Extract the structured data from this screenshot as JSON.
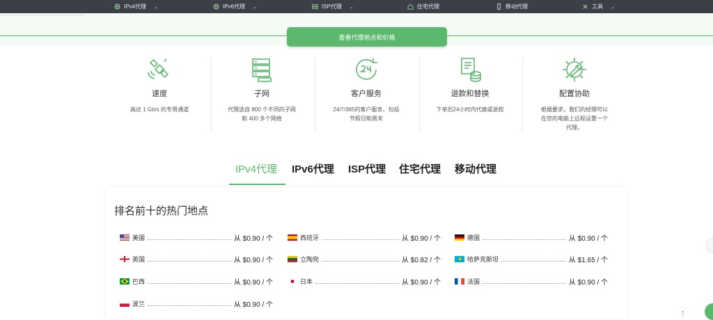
{
  "nav": {
    "items": [
      {
        "label": "IPv4代理",
        "icon": "globe-icon",
        "has_dropdown": true
      },
      {
        "label": "IPv6代理",
        "icon": "globe-icon",
        "has_dropdown": true
      },
      {
        "label": "ISP代理",
        "icon": "server-icon",
        "has_dropdown": true
      },
      {
        "label": "住宅代理",
        "icon": "home-icon",
        "has_dropdown": false
      },
      {
        "label": "移动代理",
        "icon": "mobile-icon",
        "has_dropdown": false
      },
      {
        "label": "工具",
        "icon": "tools-icon",
        "has_dropdown": true
      }
    ]
  },
  "cta": {
    "label": "查看代理地点和价格"
  },
  "features": [
    {
      "icon": "satellite-icon",
      "title": "速度",
      "desc": [
        "高达 1 Gb/s 的专用通道"
      ]
    },
    {
      "icon": "server-stack-icon",
      "title": "子网",
      "desc": [
        "代理选自 800 个不同的子网",
        "和 400 多个网络"
      ]
    },
    {
      "icon": "clock-24-icon",
      "title": "客户服务",
      "desc": [
        "24/7/365的客户服务，包括",
        "节假日和周末"
      ]
    },
    {
      "icon": "refund-icon",
      "title": "退款和替换",
      "desc": [
        "下单后24小时内代换或退款"
      ]
    },
    {
      "icon": "gear-wrench-icon",
      "title": "配置协助",
      "desc": [
        "根据要求，我们的经理可以",
        "在您的电脑上远程设置一个",
        "代理。"
      ]
    }
  ],
  "tabs": [
    {
      "label": "IPv4代理",
      "active": true
    },
    {
      "label": "IPv6代理",
      "active": false
    },
    {
      "label": "ISP代理",
      "active": false
    },
    {
      "label": "住宅代理",
      "active": false
    },
    {
      "label": "移动代理",
      "active": false
    }
  ],
  "locations": {
    "title": "排名前十的热门地点",
    "items": [
      {
        "name": "美国",
        "price": "从 $0.90 / 个",
        "flag": "us-flag"
      },
      {
        "name": "西班牙",
        "price": "从 $0.90 / 个",
        "flag": "es-flag"
      },
      {
        "name": "德国",
        "price": "从 $0.90 / 个",
        "flag": "de-flag"
      },
      {
        "name": "英国",
        "price": "从 $0.90 / 个",
        "flag": "gb-flag"
      },
      {
        "name": "立陶宛",
        "price": "从 $0.82 / 个",
        "flag": "lt-flag"
      },
      {
        "name": "哈萨克斯坦",
        "price": "从 $1.65 / 个",
        "flag": "kz-flag"
      },
      {
        "name": "巴西",
        "price": "从 $0.90 / 个",
        "flag": "br-flag"
      },
      {
        "name": "日本",
        "price": "从 $0.90 / 个",
        "flag": "jp-flag"
      },
      {
        "name": "法国",
        "price": "从 $0.90 / 个",
        "flag": "fr-flag"
      },
      {
        "name": "波兰",
        "price": "从 $0.90 / 个",
        "flag": "pl-flag"
      }
    ]
  },
  "colors": {
    "accent": "#5cb86c",
    "nav_bg": "#3c3f47"
  }
}
